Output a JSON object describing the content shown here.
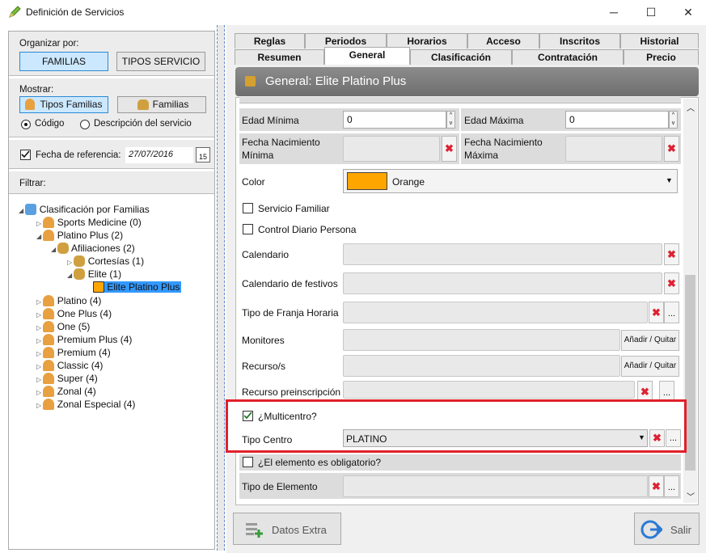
{
  "window": {
    "title": "Definición de Servicios",
    "minimize": "─",
    "maximize": "☐",
    "close": "✕"
  },
  "left": {
    "organizar_label": "Organizar por:",
    "btn_familias": "FAMILIAS",
    "btn_tipos_servicio": "TIPOS SERVICIO",
    "mostrar_label": "Mostrar:",
    "btn_tipos_familias": "Tipos Familias",
    "btn_familias2": "Familias",
    "radio_codigo": "Código",
    "radio_descripcion": "Descripción del servicio",
    "fecha_label": "Fecha de referencia:",
    "fecha_value": "27/07/2016",
    "cal_day": "15",
    "filtrar_label": "Filtrar:"
  },
  "tree": [
    {
      "label": "Clasificación por Familias"
    },
    {
      "label": "Sports Medicine (0)"
    },
    {
      "label": "Platino Plus (2)"
    },
    {
      "label": "Afiliaciones (2)"
    },
    {
      "label": "Cortesías (1)"
    },
    {
      "label": "Elite (1)"
    },
    {
      "label": "Elite Platino Plus"
    },
    {
      "label": "Platino (4)"
    },
    {
      "label": "One Plus (4)"
    },
    {
      "label": "One (5)"
    },
    {
      "label": "Premium Plus (4)"
    },
    {
      "label": "Premium (4)"
    },
    {
      "label": "Classic (4)"
    },
    {
      "label": "Super (4)"
    },
    {
      "label": "Zonal (4)"
    },
    {
      "label": "Zonal Especial (4)"
    }
  ],
  "tabs_top": [
    "Reglas",
    "Periodos",
    "Horarios",
    "Acceso",
    "Inscritos",
    "Historial"
  ],
  "tabs_bottom": [
    "Resumen",
    "General",
    "Clasificación",
    "Contratación",
    "Precio"
  ],
  "header": {
    "title": "General: Elite Platino Plus"
  },
  "form": {
    "edad_min_label": "Edad Mínima",
    "edad_min_value": "0",
    "edad_max_label": "Edad Máxima",
    "edad_max_value": "0",
    "fnac_min_label": "Fecha Nacimiento Mínima",
    "fnac_max_label": "Fecha Nacimiento Máxima",
    "color_label": "Color",
    "color_value": "Orange",
    "color_hex": "#ffa500",
    "servicio_familiar": "Servicio Familiar",
    "control_diario": "Control Diario Persona",
    "calendario": "Calendario",
    "calendario_festivos": "Calendario de festivos",
    "tipo_franja": "Tipo de Franja Horaria",
    "monitores": "Monitores",
    "recursos": "Recurso/s",
    "anadir_quitar": "Añadir / Quitar",
    "recurso_pre": "Recurso preinscripción",
    "multicentro": "¿Multicentro?",
    "tipo_centro_label": "Tipo Centro",
    "tipo_centro_value": "PLATINO",
    "obligatorio": "¿El elemento es obligatorio?",
    "tipo_elemento": "Tipo de Elemento",
    "x": "✖",
    "dots": "..."
  },
  "footer": {
    "datos_extra": "Datos Extra",
    "salir": "Salir"
  },
  "colors": {
    "highlight": "#e0202a",
    "selection": "#3399ff"
  }
}
